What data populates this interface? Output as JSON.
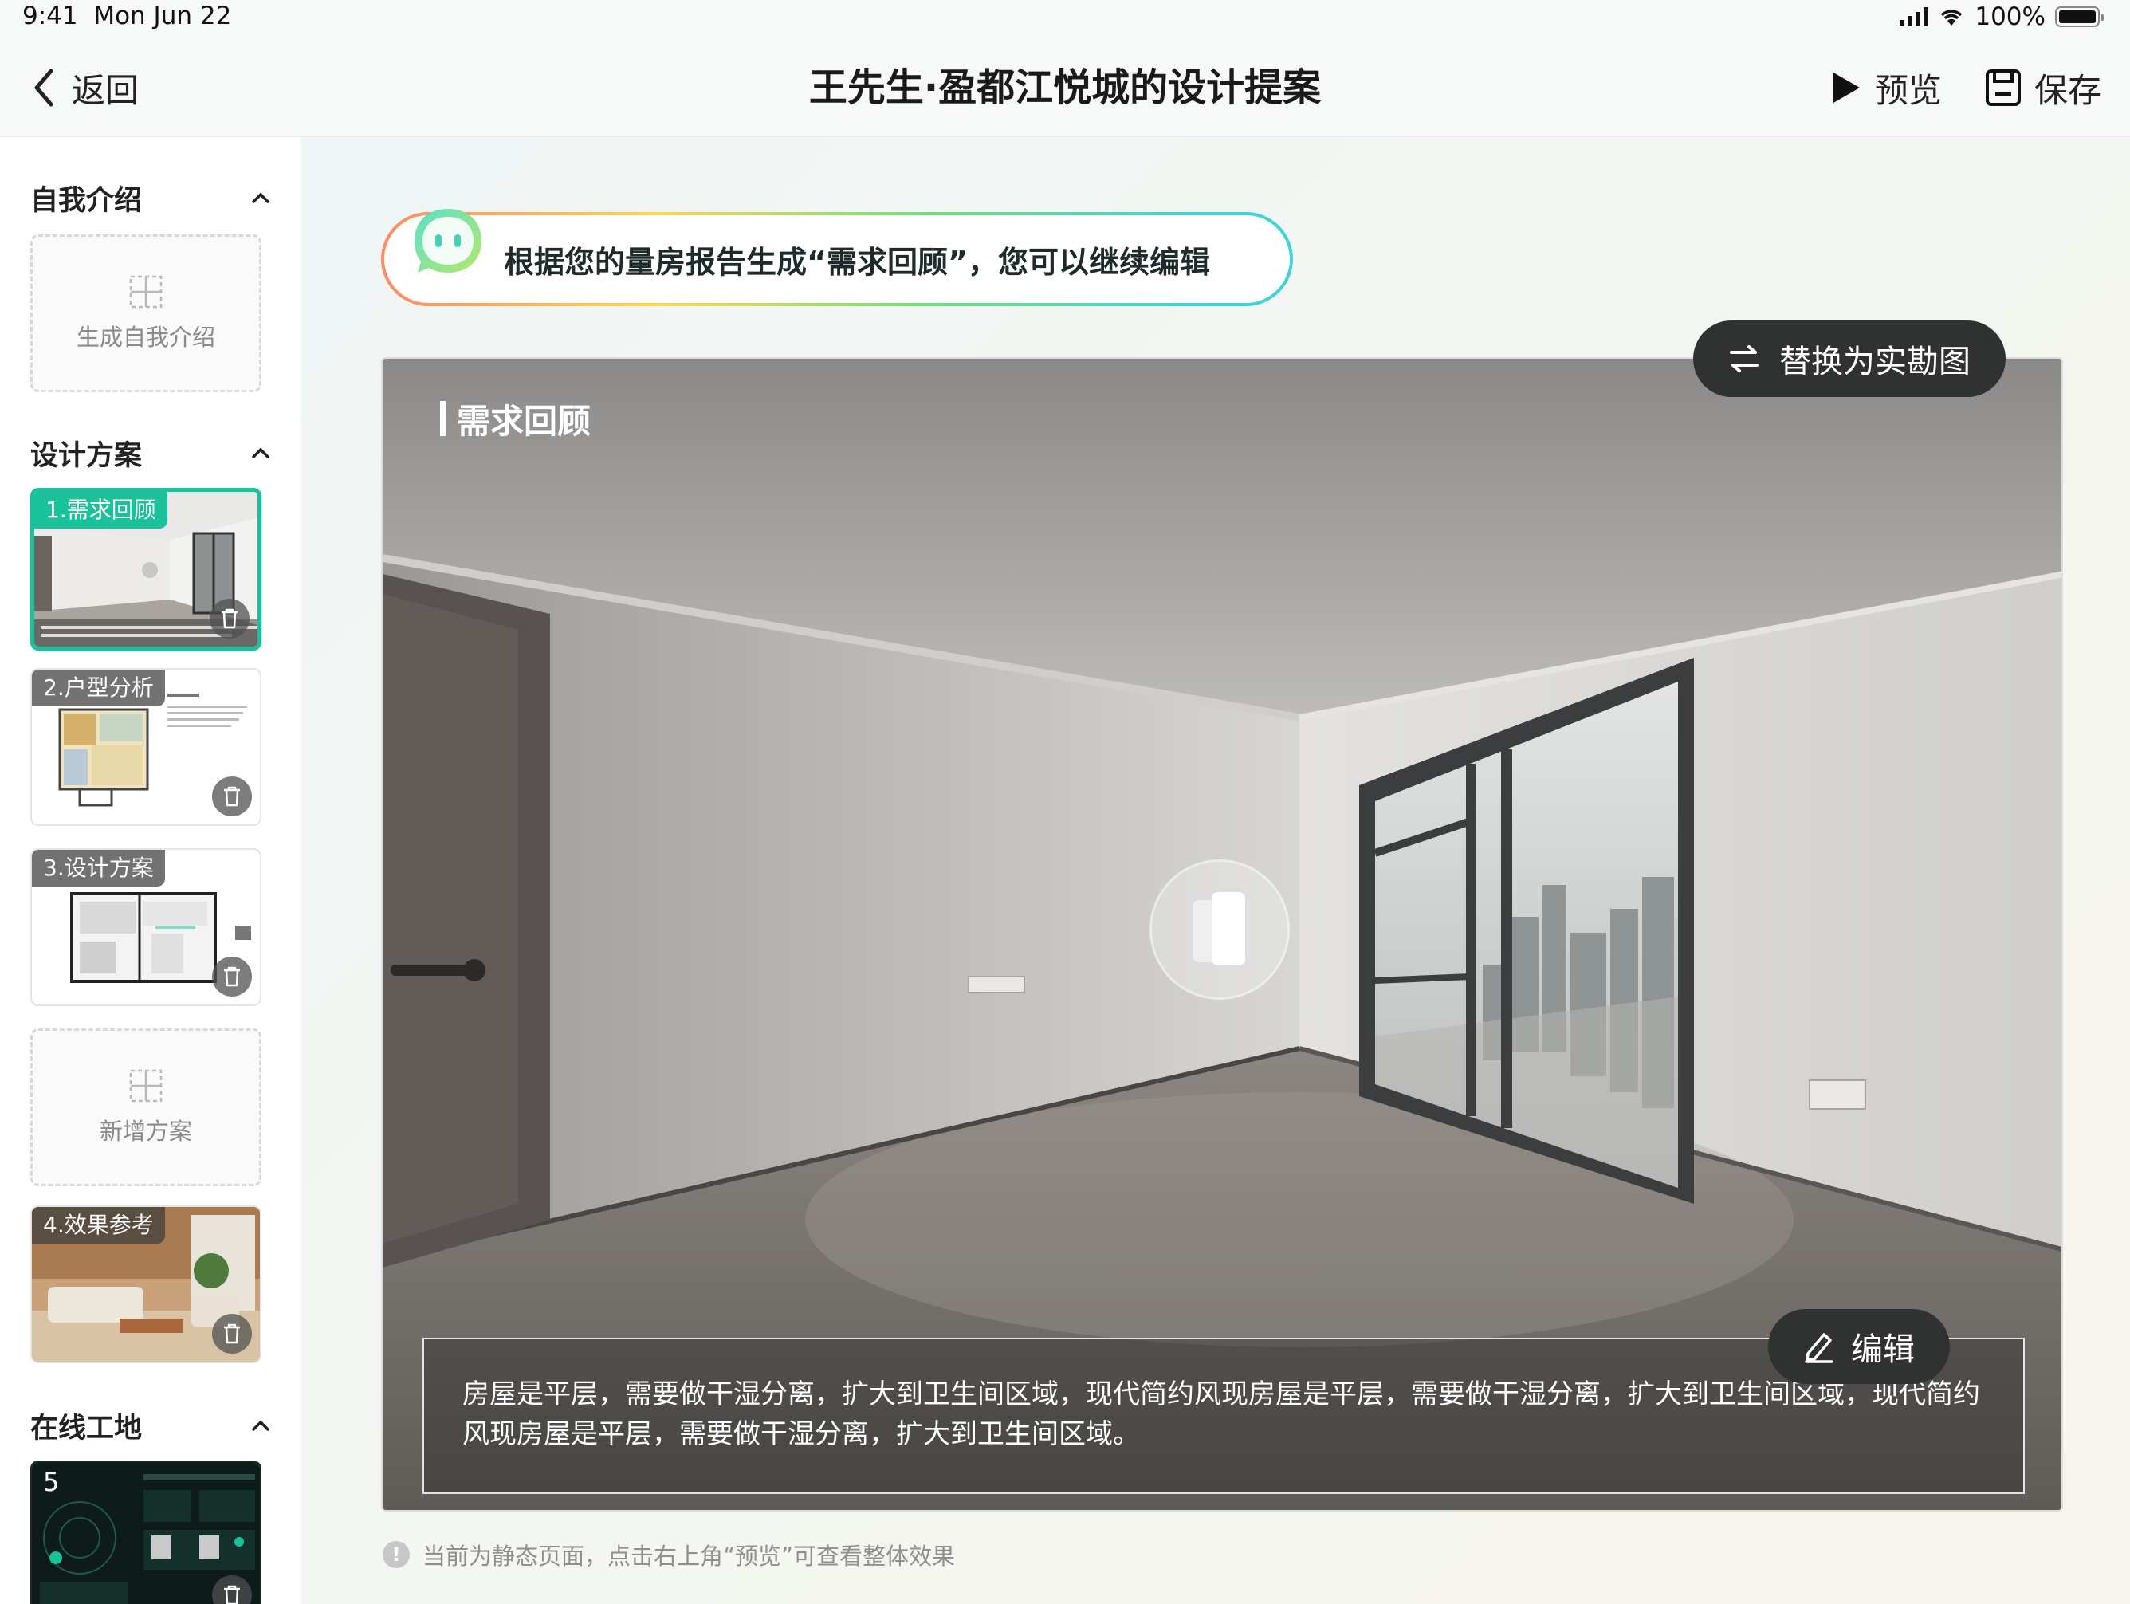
{
  "status_bar": {
    "time": "9:41",
    "date": "Mon Jun 22",
    "battery": "100%"
  },
  "nav": {
    "back_label": "返回",
    "title": "王先生·盈都江悦城的设计提案",
    "preview_label": "预览",
    "save_label": "保存"
  },
  "sidebar": {
    "sections": [
      {
        "title": "自我介绍"
      },
      {
        "title": "设计方案"
      },
      {
        "title": "在线工地"
      }
    ],
    "add_intro_label": "生成自我介绍",
    "add_plan_label": "新增方案",
    "cards": [
      {
        "label": "1.需求回顾",
        "selected": true
      },
      {
        "label": "2.户型分析"
      },
      {
        "label": "3.设计方案"
      },
      {
        "label": "4.效果参考"
      }
    ],
    "site_card_number": "5"
  },
  "main": {
    "ai_banner_text": "根据您的量房报告生成“需求回顾”，您可以继续编辑",
    "replace_button_label": "替换为实勘图",
    "hero_title": "需求回顾",
    "description": "房屋是平层，需要做干湿分离，扩大到卫生间区域，现代简约风现房屋是平层，需要做干湿分离，扩大到卫生间区域，现代简约风现房屋是平层，需要做干湿分离，扩大到卫生间区域。",
    "edit_label": "编辑",
    "hint_text": "当前为静态页面，点击右上角“预览”可查看整体效果"
  },
  "colors": {
    "accent": "#19c29a",
    "dark_button": "#2f3231"
  },
  "icons": [
    "chevron-left-icon",
    "play-icon",
    "save-icon",
    "chevron-up-icon",
    "add-grid-icon",
    "trash-icon",
    "swap-icon",
    "vr-icon",
    "pencil-icon",
    "info-icon",
    "bot-icon"
  ]
}
